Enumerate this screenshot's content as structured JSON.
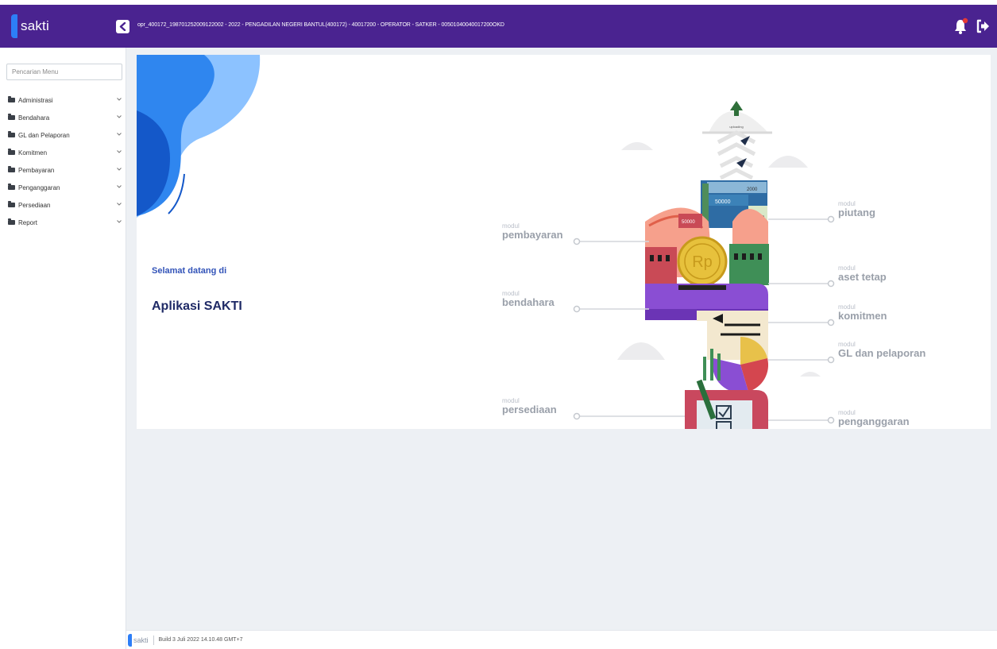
{
  "header": {
    "brand": "sakti",
    "user_info": "opr_400172_198701252009122002 - 2022 - PENGADILAN NEGERI BANTUL(400172) - 40017200 - OPERATOR - SATKER - 00501040040017200OKD",
    "icons": {
      "toggle": "chevron-left-icon",
      "notification": "bell-icon",
      "logout": "logout-icon"
    },
    "colors": {
      "bar": "#4a2390",
      "brand_mark": "#2d7ef7",
      "badge": "#e53935"
    }
  },
  "sidebar": {
    "search_placeholder": "Pencarian Menu",
    "items": [
      {
        "label": "Administrasi"
      },
      {
        "label": "Bendahara"
      },
      {
        "label": "GL dan Pelaporan"
      },
      {
        "label": "Komitmen"
      },
      {
        "label": "Pembayaran"
      },
      {
        "label": "Penganggaran"
      },
      {
        "label": "Persediaan"
      },
      {
        "label": "Report"
      }
    ]
  },
  "main": {
    "welcome": "Selamat datang di",
    "app_title": "Aplikasi SAKTI",
    "illustration": {
      "uploading_label": "uploading",
      "bill_values": [
        "50000",
        "50000",
        "2000",
        "50000"
      ],
      "coin_label": "Rp",
      "modul_prefix": "modul",
      "modules_left": [
        "pembayaran",
        "bendahara",
        "persediaan"
      ],
      "modules_right": [
        "piutang",
        "aset tetap",
        "komitmen",
        "GL dan pelaporan",
        "penganggaran"
      ]
    }
  },
  "footer": {
    "logo": "sakti",
    "build": "Build 3 Juli 2022 14.10.48 GMT+7"
  }
}
